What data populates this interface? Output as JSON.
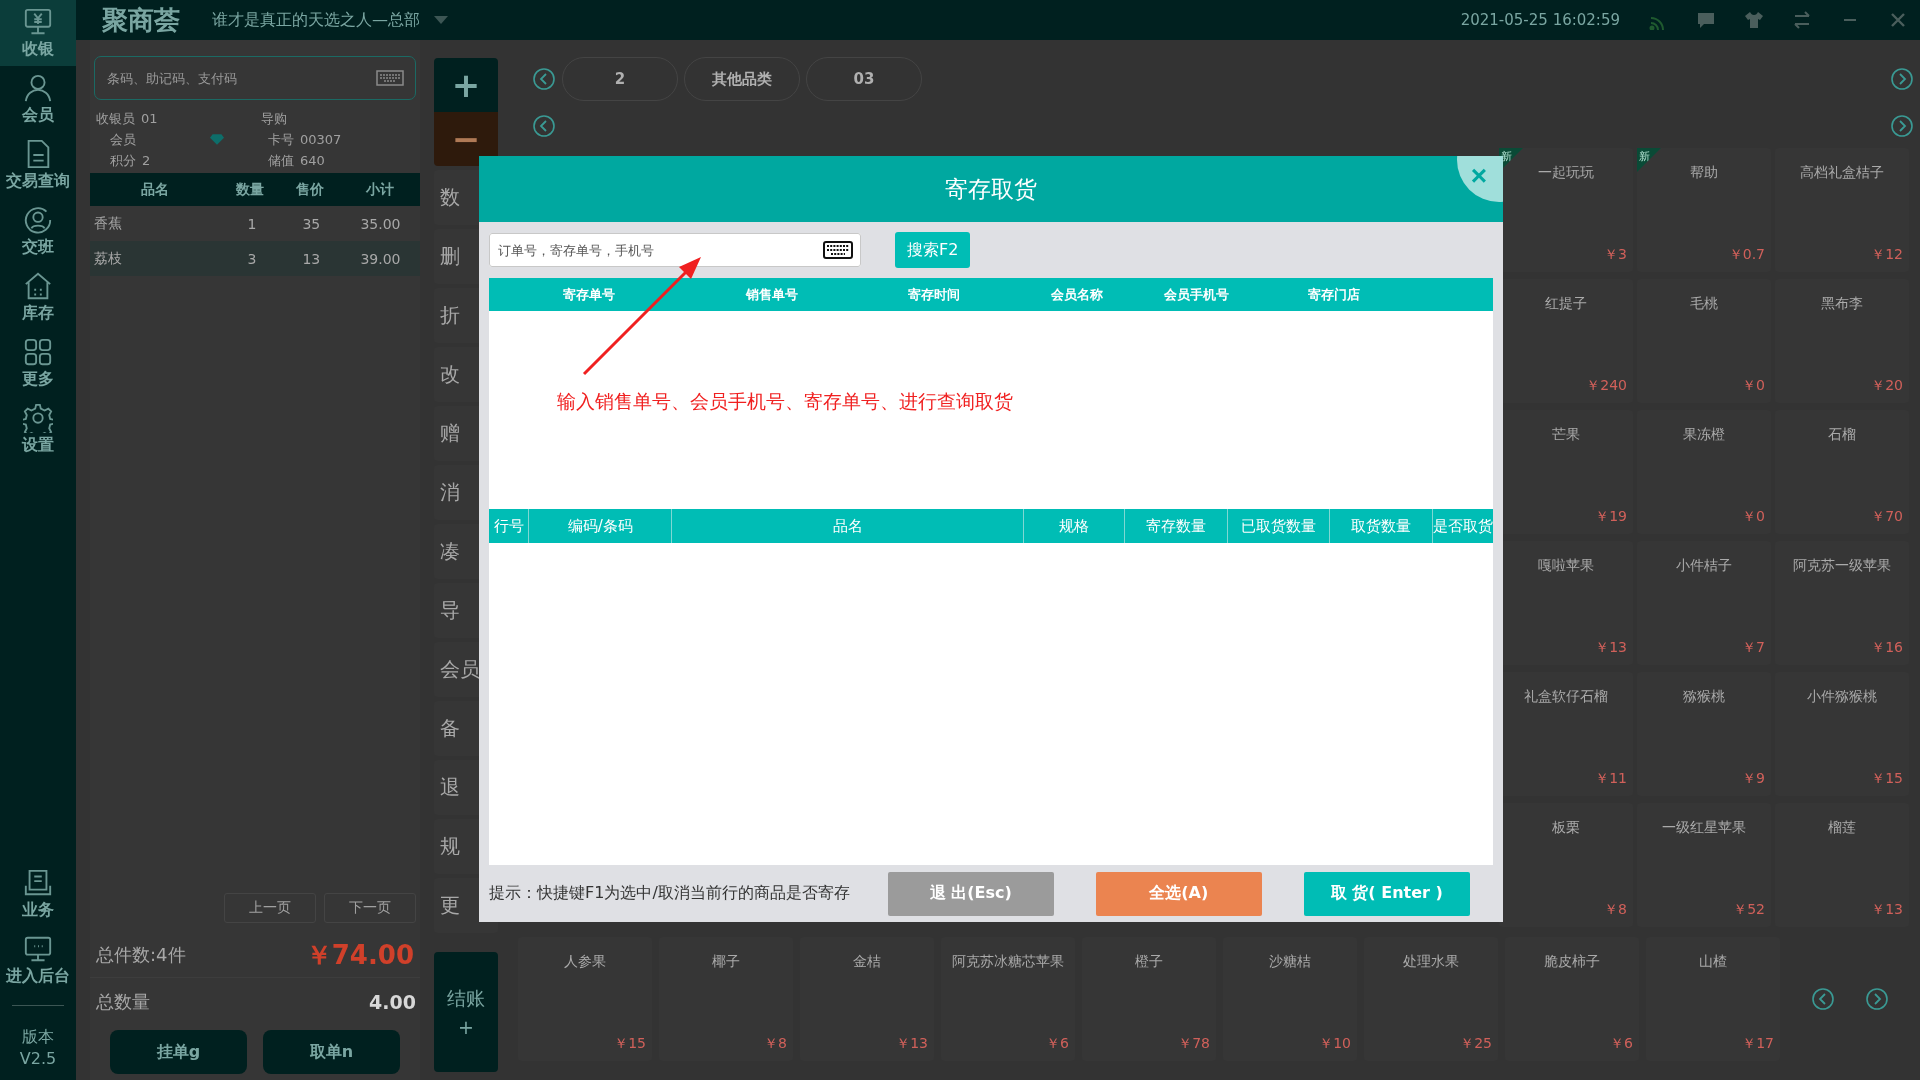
{
  "sidebar": {
    "items": [
      {
        "label": "收银",
        "selected": true
      },
      {
        "label": "会员",
        "selected": false
      },
      {
        "label": "交易查询",
        "selected": false
      },
      {
        "label": "交班",
        "selected": false
      },
      {
        "label": "库存",
        "selected": false
      },
      {
        "label": "更多",
        "selected": false
      },
      {
        "label": "设置",
        "selected": false
      }
    ],
    "bottom_items": [
      {
        "label": "业务"
      },
      {
        "label": "进入后台"
      }
    ],
    "version_label": "版本",
    "version": "V2.5"
  },
  "top_bar": {
    "logo": "聚商荟",
    "store": "谁才是真正的天选之人—总部",
    "datetime": "2021-05-25 16:02:59"
  },
  "cart": {
    "search": {
      "placeholder": "条码、助记码、支付码"
    },
    "info": {
      "cashier_label": "收银员",
      "cashier": "01",
      "guide_label": "导购",
      "member_label": "会员",
      "card_label": "卡号",
      "card": "00307",
      "points_label": "积分",
      "points": "2",
      "balance_label": "储值",
      "balance": "640"
    },
    "columns": [
      "品名",
      "数量",
      "售价",
      "小计"
    ],
    "rows": [
      {
        "name": "香蕉",
        "qty": "1",
        "price": "35",
        "subtotal": "35.00",
        "selected": false
      },
      {
        "name": "荔枝",
        "qty": "3",
        "price": "13",
        "subtotal": "39.00",
        "selected": true
      }
    ],
    "prev_page": "上一页",
    "next_page": "下一页",
    "total_items": "总件数:4件",
    "total_amount": "￥74.00",
    "total_qty_label": "总数量",
    "total_qty": "4.00",
    "buttons": [
      "挂单g",
      "取单n"
    ]
  },
  "actions": {
    "plus": "+",
    "minus": "−",
    "items": [
      "数",
      "删",
      "折",
      "改",
      "赠",
      "消",
      "凑",
      "导",
      "会员",
      "备",
      "退",
      "规",
      "更"
    ],
    "checkout": "结账",
    "checkout_sub": "+"
  },
  "categories": [
    {
      "label": "2"
    },
    {
      "label": "其他品类"
    },
    {
      "label": "03"
    }
  ],
  "products": [
    {
      "name": "一起玩玩",
      "price": "￥3",
      "new": true,
      "badge": "新"
    },
    {
      "name": "帮助",
      "price": "￥0.7",
      "new": true,
      "badge": "新"
    },
    {
      "name": "高档礼盒桔子",
      "price": "￥12",
      "new": false
    },
    {
      "name": "红提子",
      "price": "￥240",
      "new": false
    },
    {
      "name": "毛桃",
      "price": "￥0",
      "new": false
    },
    {
      "name": "黑布李",
      "price": "￥20",
      "new": false
    },
    {
      "name": "芒果",
      "price": "￥19",
      "new": false
    },
    {
      "name": "果冻橙",
      "price": "￥0",
      "new": false
    },
    {
      "name": "石榴",
      "price": "￥70",
      "new": false
    },
    {
      "name": "嘎啦苹果",
      "price": "￥13",
      "new": false
    },
    {
      "name": "小件桔子",
      "price": "￥7",
      "new": false
    },
    {
      "name": "阿克苏一级苹果",
      "price": "￥16",
      "new": false
    },
    {
      "name": "礼盒软仔石榴",
      "price": "￥11",
      "new": false
    },
    {
      "name": "猕猴桃",
      "price": "￥9",
      "new": false
    },
    {
      "name": "小件猕猴桃",
      "price": "￥15",
      "new": false
    },
    {
      "name": "板栗",
      "price": "￥8",
      "new": false
    },
    {
      "name": "一级红星苹果",
      "price": "￥52",
      "new": false
    },
    {
      "name": "榴莲",
      "price": "￥13",
      "new": false
    }
  ],
  "bottom_products": [
    {
      "name": "人参果",
      "price": "￥15",
      "new": false
    },
    {
      "name": "椰子",
      "price": "￥8",
      "new": false
    },
    {
      "name": "金桔",
      "price": "￥13",
      "new": false
    },
    {
      "name": "阿克苏冰糖芯苹果",
      "price": "￥6",
      "new": false
    },
    {
      "name": "橙子",
      "price": "￥78",
      "new": false
    },
    {
      "name": "沙糖桔",
      "price": "￥10",
      "new": false
    },
    {
      "name": "处理水果",
      "price": "￥25",
      "new": false
    },
    {
      "name": "脆皮柿子",
      "price": "￥6",
      "new": false
    },
    {
      "name": "山楂",
      "price": "￥17",
      "new": false
    }
  ],
  "dialog": {
    "title": "寄存取货",
    "close": "×",
    "search": {
      "placeholder": "订单号，寄存单号，手机号"
    },
    "search_button": "搜索F2",
    "orders_columns": [
      "寄存单号",
      "销售单号",
      "寄存时间",
      "会员名称",
      "会员手机号",
      "寄存门店"
    ],
    "annotation": "输入销售单号、会员手机号、寄存单号、进行查询取货",
    "items_columns": [
      "行号",
      "编码/条码",
      "品名",
      "规格",
      "寄存数量",
      "已取货数量",
      "取货数量",
      "是否取货"
    ],
    "hint": "提示：快捷键F1为选中/取消当前行的商品是否寄存",
    "buttons": [
      {
        "label": "退 出(Esc)",
        "kind": "exit"
      },
      {
        "label": "全选(A)",
        "kind": "select_all"
      },
      {
        "label": "取 货( Enter )",
        "kind": "pickup"
      }
    ]
  }
}
